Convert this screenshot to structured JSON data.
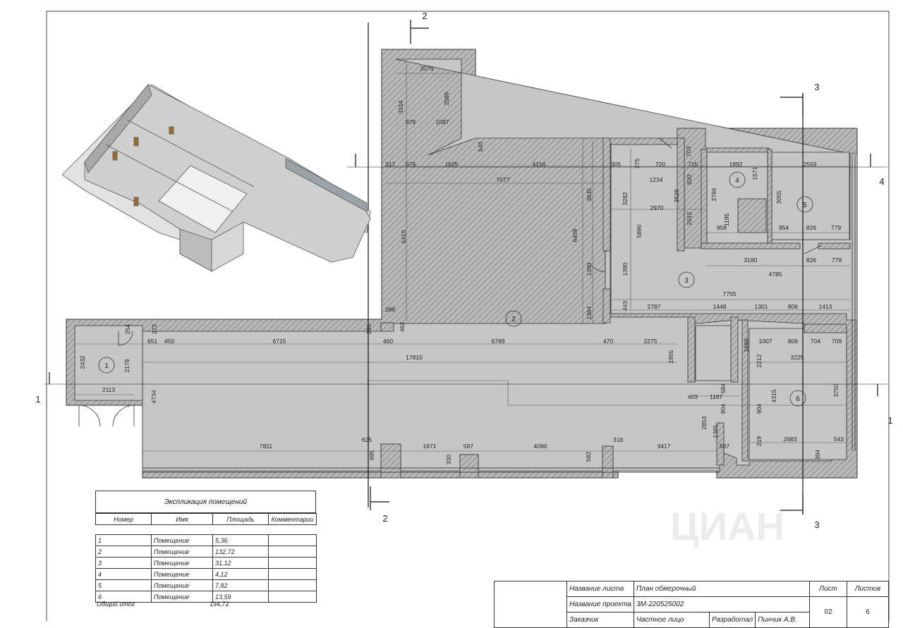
{
  "plan": {
    "section_markers": [
      {
        "id": "top-2",
        "text": "2"
      },
      {
        "id": "bottom-2",
        "text": "2"
      },
      {
        "id": "top-3",
        "text": "3"
      },
      {
        "id": "bottom-3",
        "text": "3"
      },
      {
        "id": "left-1",
        "text": "1"
      },
      {
        "id": "right-1",
        "text": "1"
      },
      {
        "id": "right-4",
        "text": "4"
      }
    ],
    "room_labels": [
      "1",
      "2",
      "3",
      "4",
      "5",
      "6"
    ],
    "dimensions": [
      "2076",
      "3154",
      "2586",
      "979",
      "1097",
      "540",
      "317",
      "979",
      "1625",
      "4156",
      "7077",
      "305",
      "275",
      "720",
      "703",
      "715",
      "1892",
      "2559",
      "1234",
      "820",
      "3538",
      "2766",
      "1571",
      "3055",
      "3635",
      "3282",
      "2970",
      "2015",
      "1195",
      "958",
      "954",
      "826",
      "779",
      "5410",
      "6409",
      "5890",
      "3180",
      "826",
      "779",
      "1390",
      "1390",
      "4785",
      "7755",
      "288",
      "1384",
      "443",
      "2787",
      "1448",
      "1301",
      "806",
      "1413",
      "462",
      "254",
      "272",
      "290",
      "651",
      "450",
      "6715",
      "460",
      "6789",
      "470",
      "2275",
      "1698",
      "1007",
      "806",
      "704",
      "709",
      "2432",
      "2178",
      "17810",
      "1955",
      "3225",
      "2113",
      "4734",
      "2212",
      "403",
      "1187",
      "584",
      "4315",
      "3750",
      "904",
      "904",
      "2853",
      "1365",
      "625",
      "1971",
      "587",
      "4090",
      "318",
      "3417",
      "587",
      "219",
      "2683",
      "543",
      "695",
      "330",
      "582",
      "394",
      "7811"
    ]
  },
  "schedule": {
    "title": "Экспликация помещений",
    "headers": [
      "Номер",
      "Имя",
      "Площадь",
      "Комментарии"
    ],
    "rows": [
      {
        "num": "1",
        "name": "Помещение",
        "area": "5,36",
        "comment": ""
      },
      {
        "num": "2",
        "name": "Помещение",
        "area": "132,72",
        "comment": ""
      },
      {
        "num": "3",
        "name": "Помещение",
        "area": "31,12",
        "comment": ""
      },
      {
        "num": "4",
        "name": "Помещение",
        "area": "4,12",
        "comment": ""
      },
      {
        "num": "5",
        "name": "Помещение",
        "area": "7,82",
        "comment": ""
      },
      {
        "num": "6",
        "name": "Помещение",
        "area": "13,59",
        "comment": ""
      }
    ],
    "total_label": "Общий итог",
    "total_value": "194,72"
  },
  "title_block": {
    "sheet_name_label": "Название листа",
    "sheet_name": "План обмерочный",
    "project_name_label": "Название проекта",
    "project_name": "3М-220525002",
    "customer_label": "Заказчик",
    "customer": "Частное лицо",
    "developer_label": "Разработал",
    "developer": "Пинчик А.В.",
    "sheet_label": "Лист",
    "sheet_value": "02",
    "sheets_label": "Листов",
    "sheets_value": "6"
  },
  "watermark": "ЦИАН"
}
